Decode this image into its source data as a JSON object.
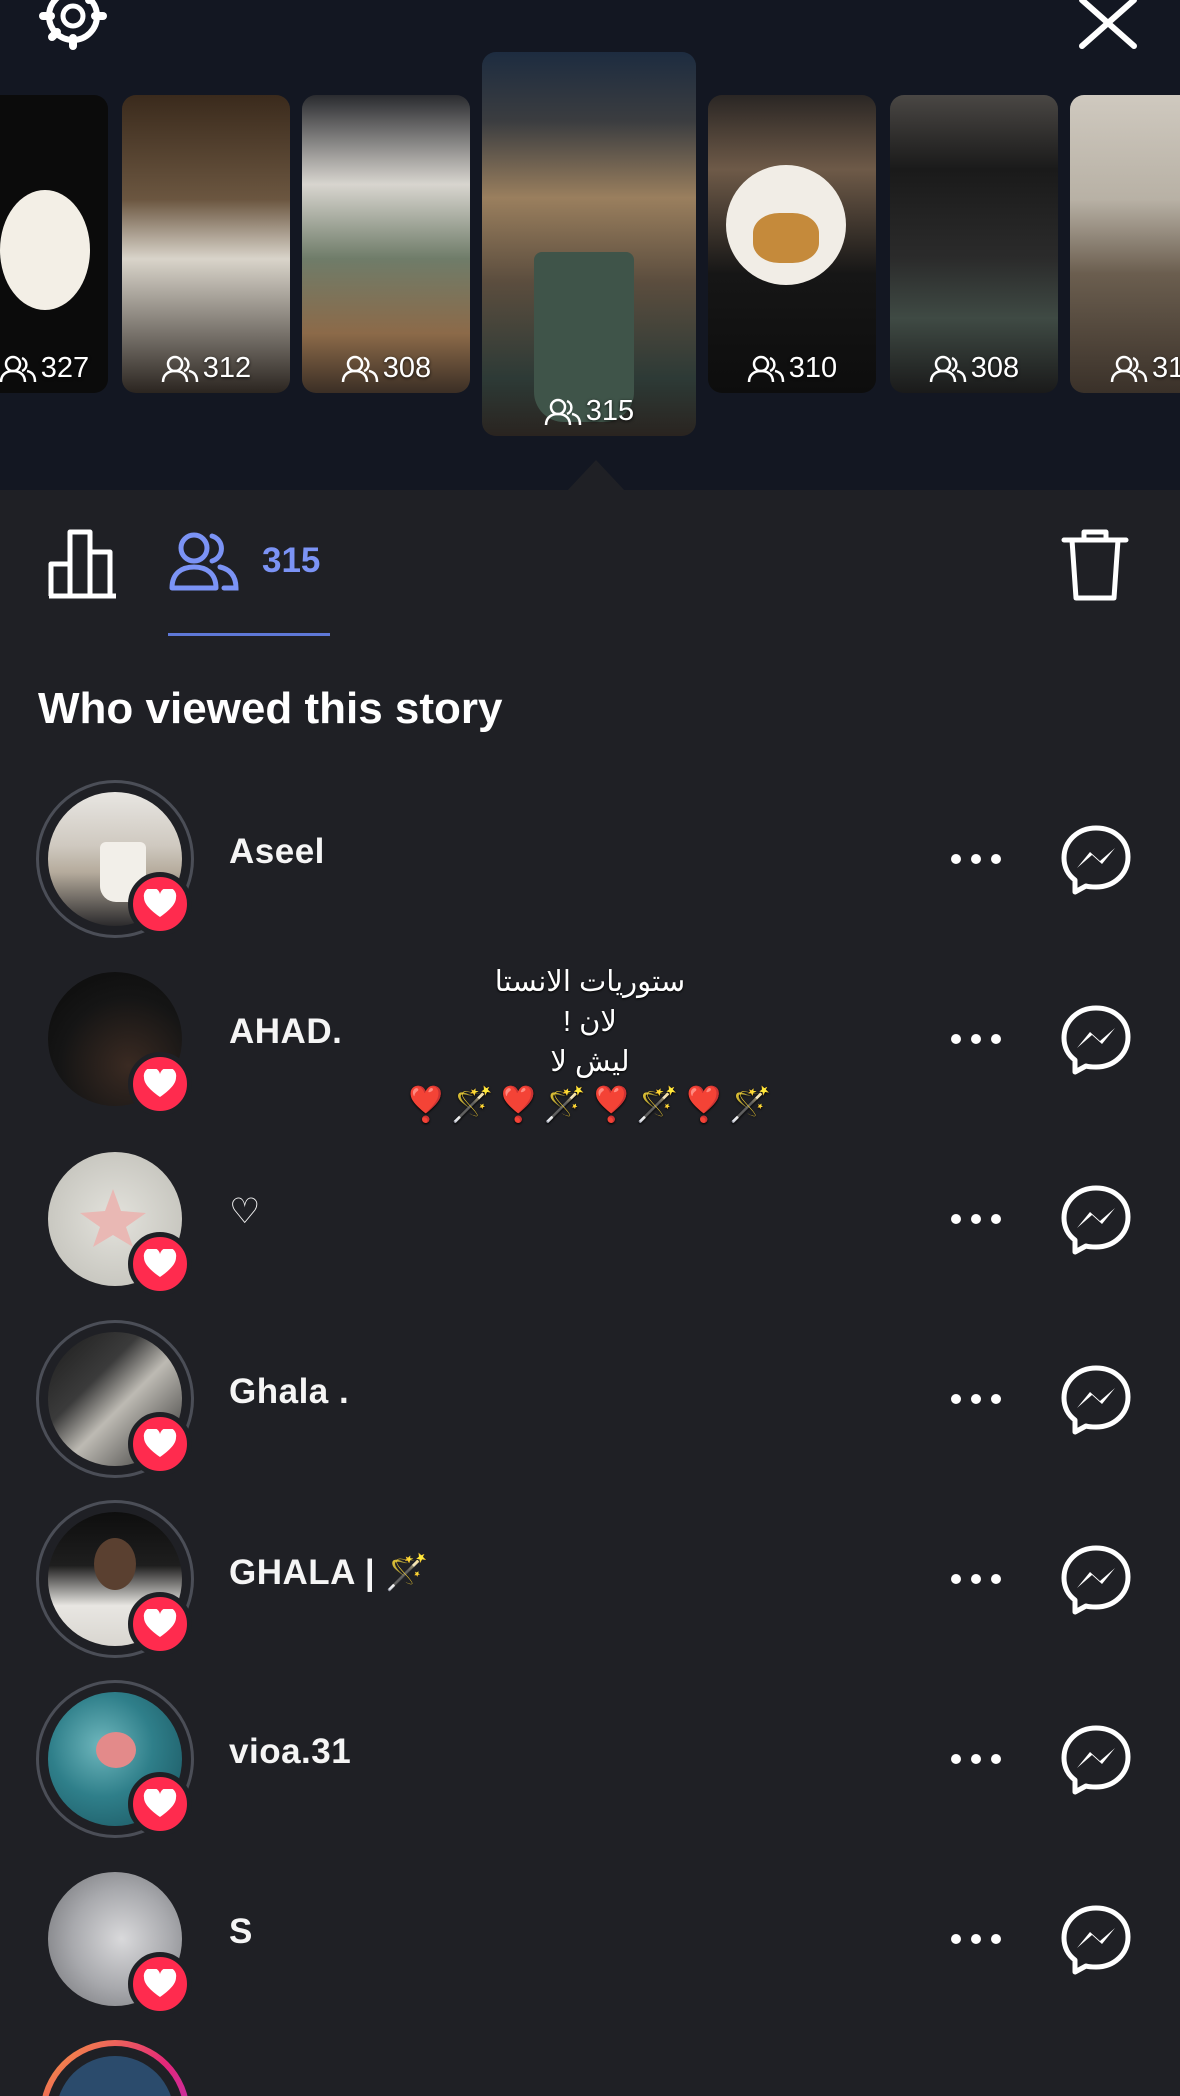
{
  "header": {
    "settings_icon": "gear-icon",
    "close_icon": "close-icon"
  },
  "stories": [
    {
      "views": "327"
    },
    {
      "views": "312"
    },
    {
      "views": "308"
    },
    {
      "views": "315",
      "selected": true
    },
    {
      "views": "310"
    },
    {
      "views": "308"
    },
    {
      "views": "31"
    }
  ],
  "tabs": {
    "insights_icon": "bar-chart-icon",
    "viewers_icon": "people-icon",
    "viewers_count": "315",
    "trash_icon": "trash-icon"
  },
  "section_title": "Who viewed this story",
  "viewers": [
    {
      "name": "Aseel"
    },
    {
      "name": "AHAD."
    },
    {
      "name": "♡"
    },
    {
      "name": "Ghala ."
    },
    {
      "name": "GHALA | 🪄"
    },
    {
      "name": "vioa.31"
    },
    {
      "name": "S"
    }
  ],
  "overlay": {
    "line1": "ستوريات الانستا",
    "line2": "لان !",
    "line3": "ليش لا",
    "emoji_line": "❣️🪄❣️🪄❣️🪄❣️🪄"
  },
  "colors": {
    "background": "#1f2025",
    "top_strip": "#131722",
    "accent": "#7b93f5",
    "heart": "#ff2b4e"
  }
}
